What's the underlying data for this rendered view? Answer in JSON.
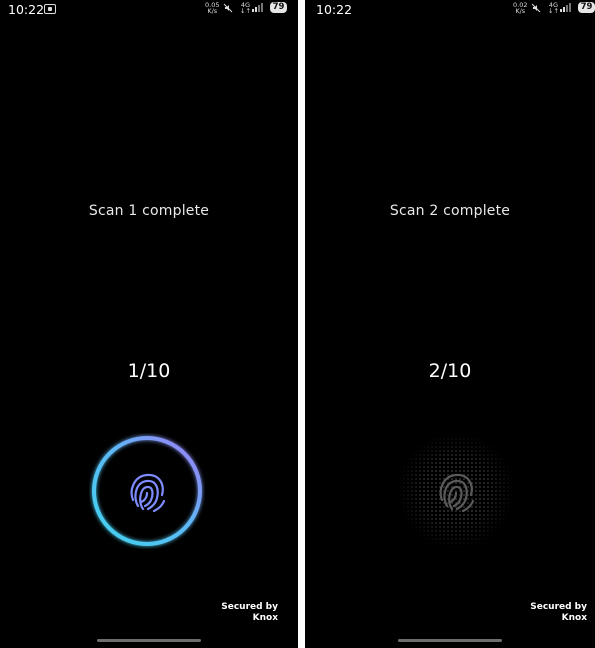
{
  "screens": [
    {
      "status_bar": {
        "time": "10:22",
        "net_speed_value": "0.05",
        "net_speed_unit": "K/s",
        "net_type": "4G",
        "net_arrows": "↓↑",
        "battery": "79"
      },
      "scan_message": "Scan 1 complete",
      "progress": "1/10",
      "sensor_state": "active",
      "secured_line1": "Secured by",
      "secured_line2": "Knox"
    },
    {
      "status_bar": {
        "time": "10:22",
        "net_speed_value": "0.02",
        "net_speed_unit": "K/s",
        "net_type": "4G",
        "net_arrows": "↓↑",
        "battery": "79"
      },
      "scan_message": "Scan 2 complete",
      "progress": "2/10",
      "sensor_state": "idle",
      "secured_line1": "Secured by",
      "secured_line2": "Knox"
    }
  ],
  "colors": {
    "ring_cyan": "#4fd6f0",
    "ring_purple": "#8b7df5",
    "fingerprint_active": "#7e8cff",
    "fingerprint_idle": "#5a5a5a"
  },
  "icons": {
    "screenshot": "screenshot-icon",
    "mute": "mute-icon",
    "signal": "signal-icon",
    "fingerprint": "fingerprint-icon"
  }
}
